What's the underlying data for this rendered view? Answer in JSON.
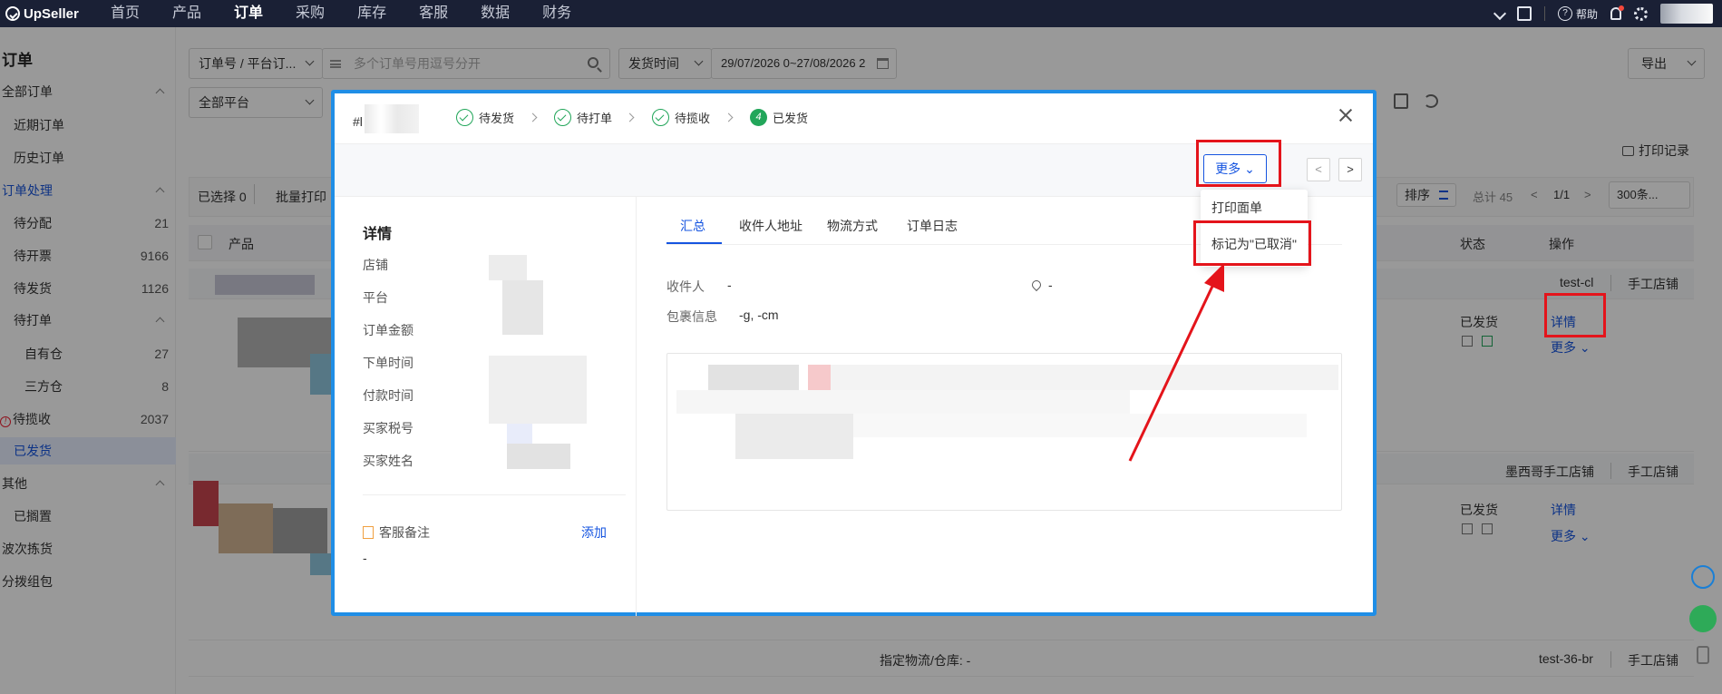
{
  "topbar": {
    "brand": "UpSeller",
    "nav": [
      "首页",
      "产品",
      "订单",
      "采购",
      "库存",
      "客服",
      "数据",
      "财务"
    ],
    "active_nav": "订单",
    "help": "帮助"
  },
  "sidebar": {
    "title": "订单",
    "all_orders": "全部订单",
    "recent": "近期订单",
    "history": "历史订单",
    "processing": "订单处理",
    "items": [
      {
        "label": "待分配",
        "count": "21"
      },
      {
        "label": "待开票",
        "count": "9166"
      },
      {
        "label": "待发货",
        "count": "1126"
      }
    ],
    "to_print": "待打单",
    "own_wh": {
      "label": "自有仓",
      "count": "27"
    },
    "third_wh": {
      "label": "三方仓",
      "count": "8"
    },
    "to_pickup": {
      "label": "待揽收",
      "count": "2037"
    },
    "shipped": "已发货",
    "other": "其他",
    "shelved": "已搁置",
    "wave_pick": "波次拣货",
    "sort_pack": "分拨组包"
  },
  "filters": {
    "order_select": "订单号 / 平台订...",
    "search_placeholder": "多个订单号用逗号分开",
    "time_type": "发货时间",
    "date_range": "29/07/2026 0~27/08/2026 2",
    "platform": "全部平台",
    "export": "导出",
    "print_log": "打印记录"
  },
  "toolbar": {
    "selected": "已选择 0",
    "batch_print": "批量打印",
    "sort": "排序",
    "total": "总计 45",
    "page": "1/1",
    "per_page": "300条..."
  },
  "table": {
    "headers": {
      "product": "产品",
      "status": "状态",
      "action": "操作"
    },
    "groups": [
      {
        "store": "test-cl",
        "type": "手工店铺"
      },
      {
        "store": "墨西哥手工店铺",
        "type": "手工店铺"
      },
      {
        "store": "test-36-br",
        "type": "手工店铺"
      }
    ],
    "status_shipped": "已发货",
    "details": "详情",
    "more": "更多",
    "logistics_note": "指定物流/仓库: -"
  },
  "modal": {
    "order_no": "#l",
    "steps": [
      {
        "label": "待发货",
        "done": true
      },
      {
        "label": "待打单",
        "done": true
      },
      {
        "label": "待揽收",
        "done": true
      },
      {
        "label": "已发货",
        "num": "4"
      }
    ],
    "more": "更多",
    "prev": "<",
    "next": ">",
    "menu": [
      "打印面单",
      "标记为\"已取消\""
    ],
    "details_title": "详情",
    "fields": [
      "店铺",
      "平台",
      "订单金额",
      "下单时间",
      "付款时间",
      "买家税号",
      "买家姓名"
    ],
    "remark_label": "客服备注",
    "remark_add": "添加",
    "remark_value": "-",
    "tabs": [
      "汇总",
      "收件人地址",
      "物流方式",
      "订单日志"
    ],
    "active_tab": "汇总",
    "recipient_label": "收件人",
    "recipient_value": "-",
    "location_value": "-",
    "package_label": "包裹信息",
    "package_value": "-g, -cm"
  },
  "colors": {
    "topbar": "#1a2035",
    "accent": "#1554e0",
    "modal_border": "#1f8ee6",
    "highlight": "#e4141b",
    "success": "#22a65a"
  }
}
